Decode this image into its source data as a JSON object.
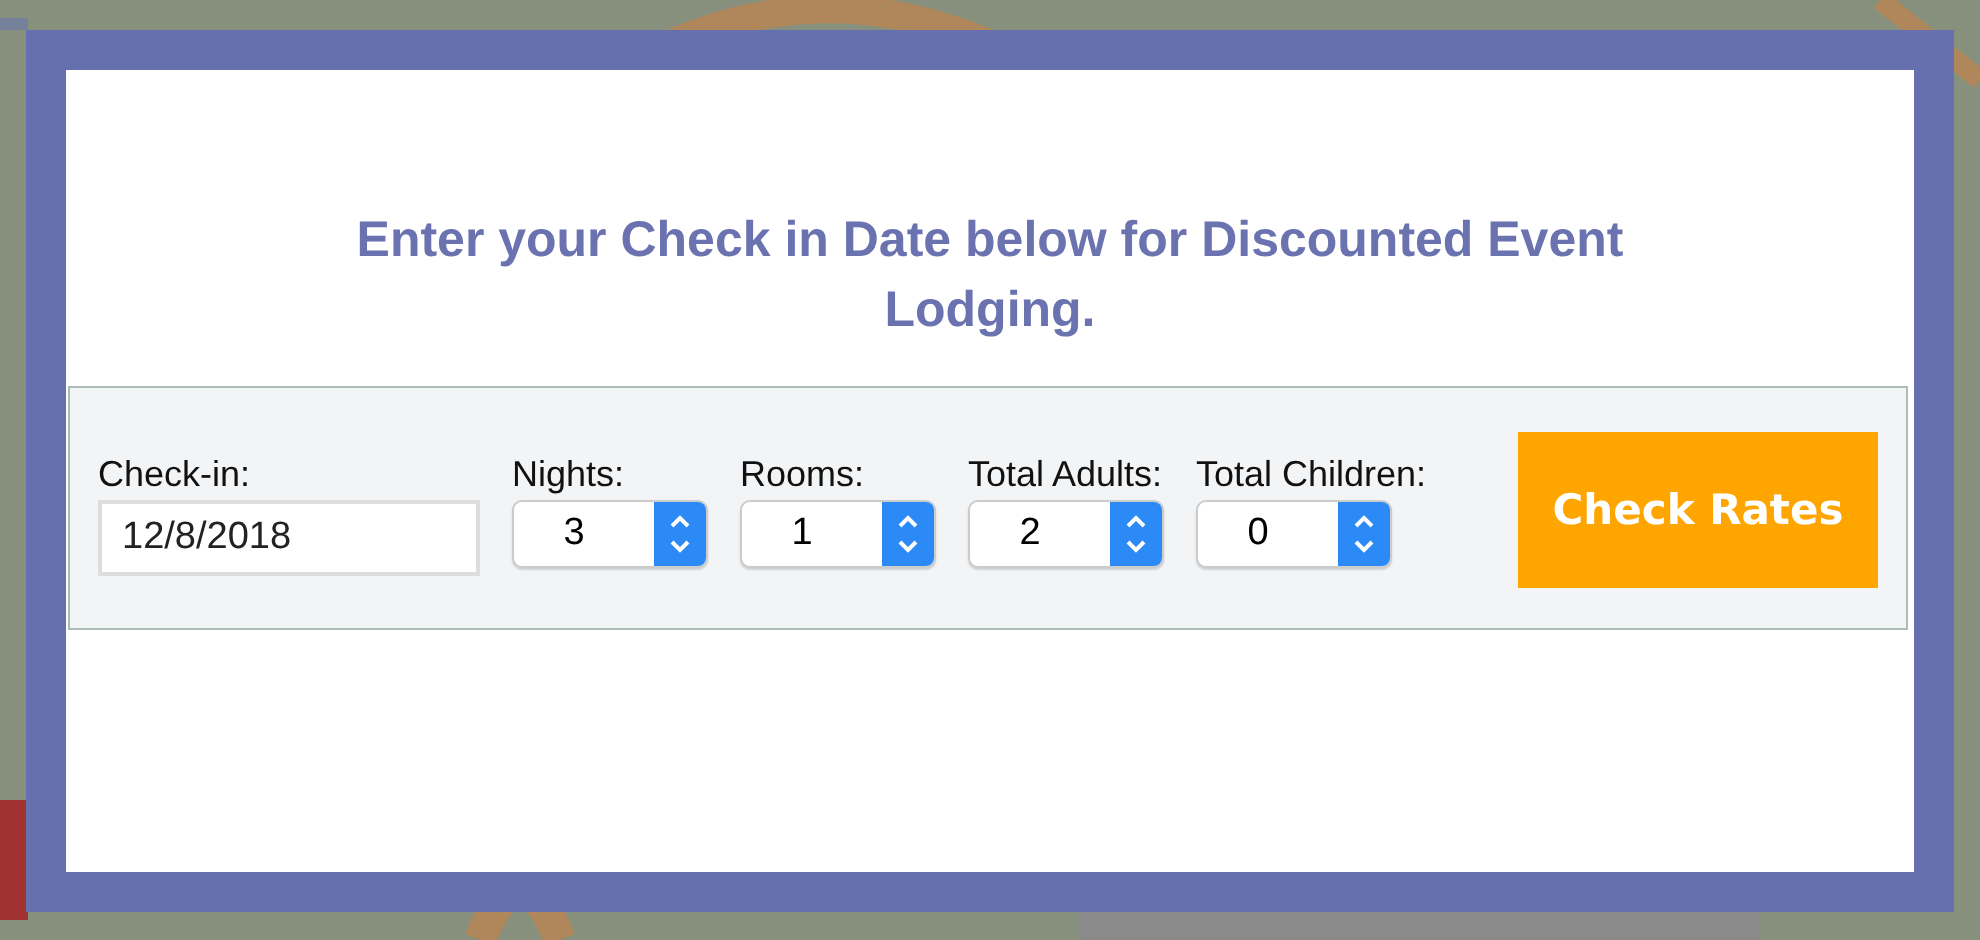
{
  "heading": "Enter your Check in Date below for Discounted Event Lodging.",
  "fields": [
    {
      "kind": "date",
      "label": "Check-in:",
      "value": "12/8/2018"
    },
    {
      "kind": "select",
      "label": "Nights:",
      "value": "3"
    },
    {
      "kind": "select",
      "label": "Rooms:",
      "value": "1"
    },
    {
      "kind": "select",
      "label": "Total Adults:",
      "value": "2"
    },
    {
      "kind": "select",
      "label": "Total Children:",
      "value": "0"
    }
  ],
  "button": "Check Rates"
}
